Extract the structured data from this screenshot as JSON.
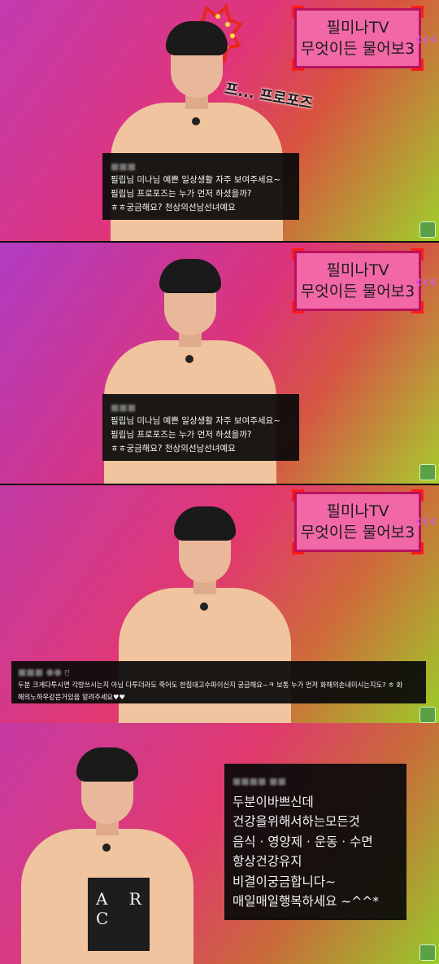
{
  "show": {
    "line1": "필미나TV",
    "line2": "무엇이든 물어보3",
    "chevrons": "‹‹‹"
  },
  "frame1": {
    "caption": "프... 프로포즈",
    "comment": {
      "lines": [
        "필립님 미나님 예쁜 일상생활 자주 보여주세요~",
        "필립님 프로포즈는 누가 먼저 하셨을까?",
        "ㅎㅎ궁금해요?  천상의선남선녀예요"
      ]
    }
  },
  "frame2": {
    "comment": {
      "lines": [
        "필립님 미나님 예쁜 일상생활 자주 보여주세요~",
        "필립님 프로포즈는 누가 먼저 하셨을까?",
        "ㅎㅎ궁금해요?  천상의선남선녀예요"
      ]
    }
  },
  "frame3": {
    "comment": {
      "time": "전",
      "lines": [
        "두분 크게다투시면 각방쓰시는지 아님 다투더라도 죽어도 한침대고수파이신지 궁금해요~ㅋ 보통 누가 먼저 화해의손내미시는지도? ㅎ 화",
        "해의노하우같은거있음 알려주세요♥♥"
      ]
    }
  },
  "frame4": {
    "sweater_print": "A R C",
    "comment": {
      "lines": [
        "두분이바쁘신데",
        "건강을위해서하는모든것",
        "음식 · 영양제  · 운동 · 수면",
        "항상건강유지",
        "비결이궁금합니다~",
        "매일매일행복하세요 ~^^*"
      ]
    }
  }
}
